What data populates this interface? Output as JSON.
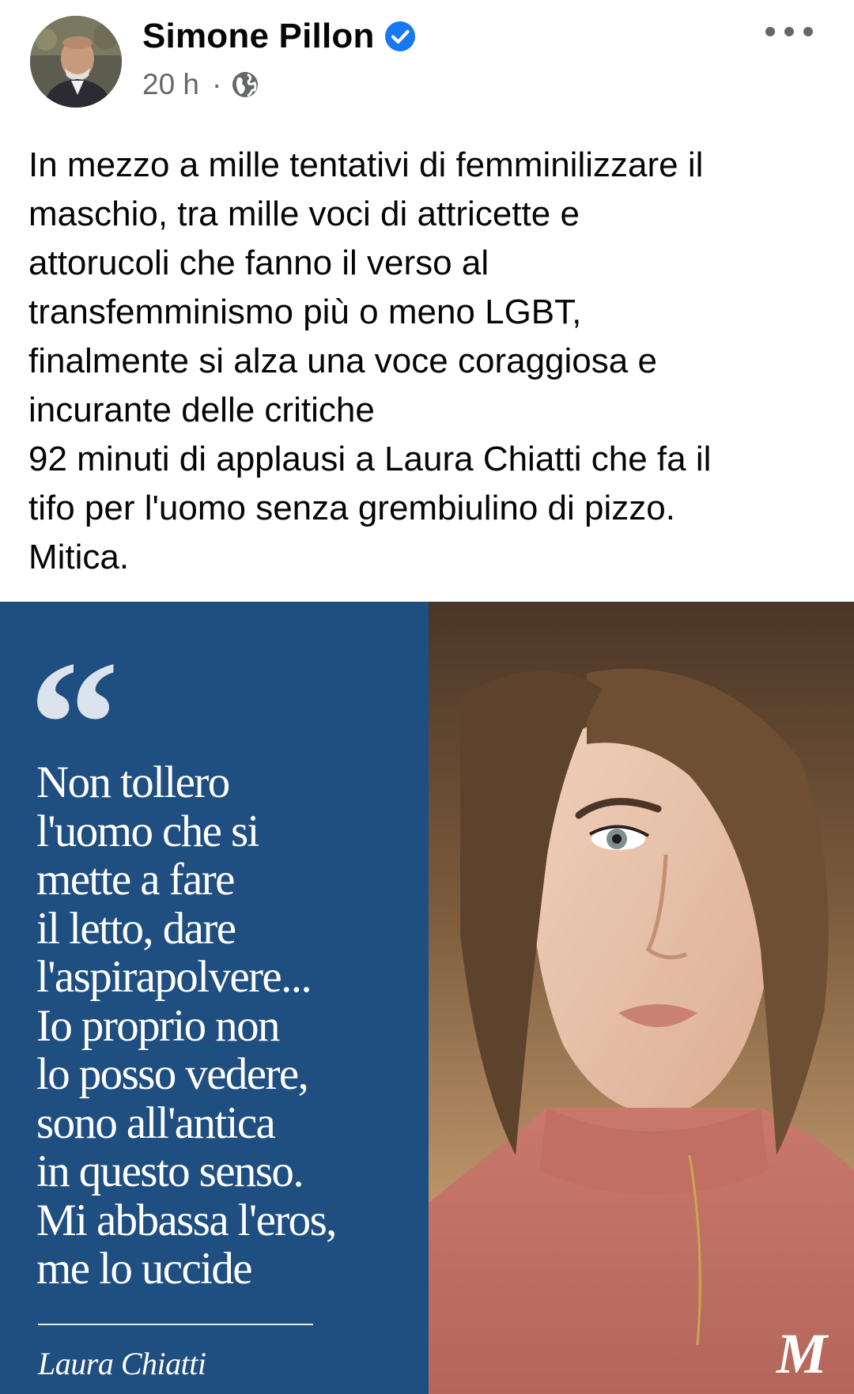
{
  "post": {
    "author": {
      "name": "Simone Pillon",
      "verified": true,
      "avatar_icon": "profile-photo-icon"
    },
    "meta": {
      "time": "20 h",
      "separator": "·",
      "audience_icon": "globe-icon"
    },
    "more_icon": "more-options-icon",
    "text_lines": [
      "In mezzo a mille tentativi di femminilizzare il",
      "maschio, tra mille voci di attricette e",
      "attorucoli che fanno il verso al",
      "transfemminismo più o meno LGBT,",
      "finalmente si alza una voce coraggiosa e",
      "incurante delle critiche",
      "92 minuti di applausi a Laura Chiatti che fa il",
      "tifo per l'uomo senza grembiulino di pizzo.",
      "Mitica."
    ]
  },
  "image": {
    "quote_mark": "“",
    "quote_lines": [
      "Non tollero",
      "l'uomo che si",
      "mette a fare",
      "il letto, dare",
      "l'aspirapolvere...",
      "Io proprio non",
      "lo posso vedere,",
      "sono all'antica",
      "in questo senso.",
      "Mi abbassa l'eros,",
      "me lo uccide"
    ],
    "quote_author": "Laura Chiatti",
    "panel_color": "#1f4e81",
    "photo_icon": "portrait-photo-icon"
  },
  "colors": {
    "verified_badge": "#1877f2",
    "secondary_text": "#65676b"
  }
}
